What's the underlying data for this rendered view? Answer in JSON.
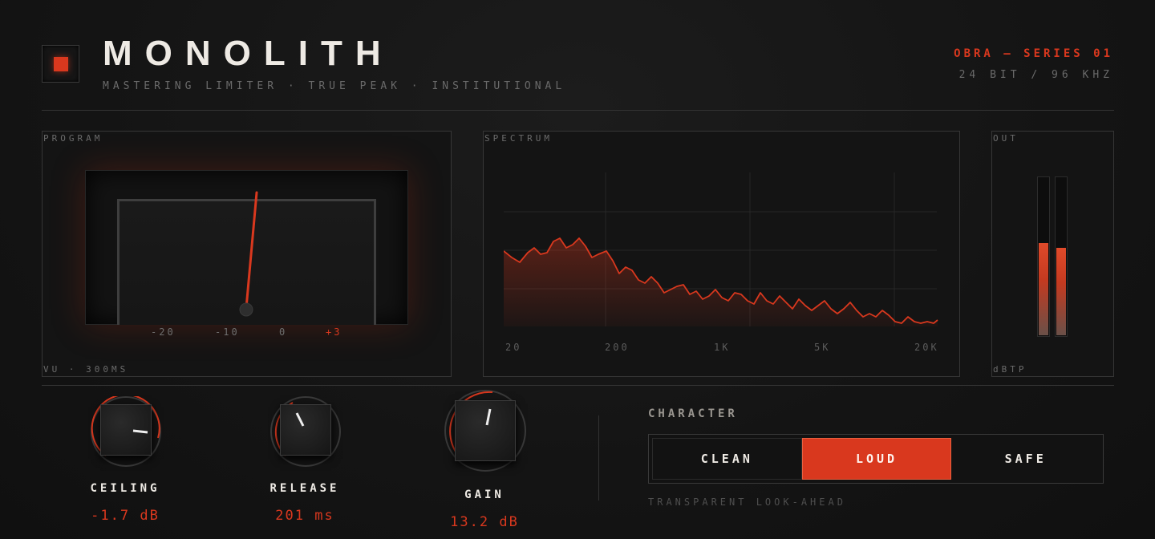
{
  "header": {
    "title": "MONOLITH",
    "subtitle": "MASTERING LIMITER · TRUE PEAK · INSTITUTIONAL",
    "series": "OBRA — SERIES 01",
    "format": "24 BIT / 96 KHZ"
  },
  "program": {
    "label": "PROGRAM",
    "footer": "VU · 300MS",
    "scale": [
      "-20",
      "-10",
      "0",
      "+3"
    ]
  },
  "spectrum": {
    "label": "SPECTRUM",
    "axis": [
      "20",
      "200",
      "1K",
      "5K",
      "20K"
    ]
  },
  "out": {
    "label": "OUT",
    "unit": "dBTP",
    "left_level": 0.58,
    "right_level": 0.55
  },
  "controls": {
    "ceiling": {
      "label": "CEILING",
      "value": "-1.7 dB"
    },
    "release": {
      "label": "RELEASE",
      "value": "201 ms"
    },
    "gain": {
      "label": "GAIN",
      "value": "13.2 dB"
    }
  },
  "character": {
    "label": "CHARACTER",
    "options": [
      "CLEAN",
      "LOUD",
      "SAFE"
    ],
    "selected": "LOUD",
    "description": "TRANSPARENT LOOK-AHEAD"
  },
  "colors": {
    "accent": "#d9381e",
    "background": "#141414",
    "text": "#eeeae4",
    "muted": "#6a6a6a"
  },
  "icons": {
    "logo": "red-square-icon"
  }
}
